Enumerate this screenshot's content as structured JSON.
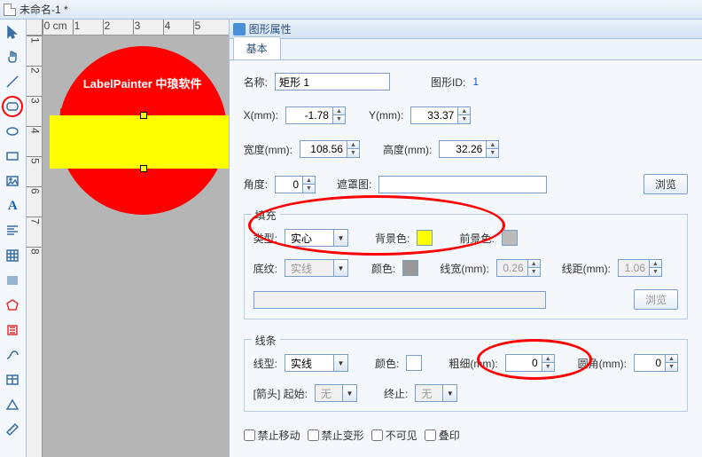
{
  "title": "未命名-1 *",
  "ruler_h": [
    "0 cm",
    "1",
    "2",
    "3",
    "4",
    "5"
  ],
  "ruler_v": [
    "1",
    "2",
    "3",
    "4",
    "5",
    "6",
    "7",
    "8"
  ],
  "canvas_text": "LabelPainter 中琅软件",
  "panel": {
    "title": "图形属性",
    "tab": "基本",
    "name_lbl": "名称:",
    "name_val": "矩形 1",
    "gid_lbl": "图形ID:",
    "gid_val": "1",
    "x_lbl": "X(mm):",
    "x_val": "-1.78",
    "y_lbl": "Y(mm):",
    "y_val": "33.37",
    "w_lbl": "宽度(mm):",
    "w_val": "108.56",
    "h_lbl": "高度(mm):",
    "h_val": "32.26",
    "ang_lbl": "角度:",
    "ang_val": "0",
    "mask_lbl": "遮罩图:",
    "browse": "浏览",
    "fill": {
      "legend": "填充",
      "type_lbl": "类型:",
      "type_val": "实心",
      "bg_lbl": "背景色:",
      "fg_lbl": "前景色:",
      "pat_lbl": "底纹:",
      "pat_val": "实线",
      "col_lbl": "颜色:",
      "lw_lbl": "线宽(mm):",
      "lw_val": "0.26",
      "ld_lbl": "线距(mm):",
      "ld_val": "1.06"
    },
    "line": {
      "legend": "线条",
      "style_lbl": "线型:",
      "style_val": "实线",
      "col_lbl": "颜色:",
      "thick_lbl": "粗细(mm):",
      "thick_val": "0",
      "round_lbl": "圆角(mm):",
      "round_val": "0",
      "arrow_lbl": "[箭头] 起始:",
      "arrow_s": "无",
      "arrow_e_lbl": "终止:",
      "arrow_e": "无"
    },
    "lock_move": "禁止移动",
    "lock_trans": "禁止变形",
    "invisible": "不可见",
    "overprint": "叠印"
  }
}
